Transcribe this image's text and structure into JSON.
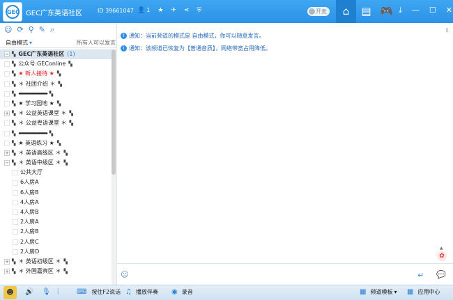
{
  "window": {
    "title": "GEC广东英语社区",
    "room_id": "ID 39661047",
    "online_count": "1",
    "open_label": "开麦"
  },
  "toolbar_icons": [
    "person-icon",
    "star-icon",
    "plane-icon",
    "share-icon",
    "shield-icon"
  ],
  "nav": [
    "home-icon",
    "list-icon",
    "gamepad-icon"
  ],
  "window_controls": [
    "download-icon",
    "minimize-icon",
    "maximize-icon",
    "close-icon"
  ],
  "left": {
    "mode": "自由模式",
    "mode_note": "所有人可以发言",
    "tree": [
      {
        "label": "GEC广东英语社区",
        "count": "(1)",
        "type": "root"
      },
      {
        "label": "公众号:GEConline",
        "type": "channel"
      },
      {
        "label": "★ 新人接待 ★",
        "type": "channel",
        "red": true
      },
      {
        "label": "＊ 社团介绍 ＊",
        "type": "channel"
      },
      {
        "label": "▬▬▬▬▬▬▬▬▬▬▬",
        "type": "divider"
      },
      {
        "label": "★ 学习园地 ★",
        "type": "channel"
      },
      {
        "label": "＊ 公益英语课堂 ＊",
        "type": "group"
      },
      {
        "label": "＊ 公益粤语课堂 ＊",
        "type": "channel"
      },
      {
        "label": "▬▬▬▬▬▬▬▬▬▬▬",
        "type": "divider"
      },
      {
        "label": "★ 英语练习 ★",
        "type": "channel"
      },
      {
        "label": "＊ 英语高级区 ＊",
        "type": "group"
      },
      {
        "label": "＊ 英语中级区 ＊",
        "type": "group-open"
      },
      {
        "label": "公共大厅",
        "type": "sub"
      },
      {
        "label": "6人房A",
        "type": "sub"
      },
      {
        "label": "6人房B",
        "type": "sub"
      },
      {
        "label": "4人房A",
        "type": "sub"
      },
      {
        "label": "4人房B",
        "type": "sub"
      },
      {
        "label": "2人房A",
        "type": "sub"
      },
      {
        "label": "2人房B",
        "type": "sub"
      },
      {
        "label": "2人房C",
        "type": "sub"
      },
      {
        "label": "2人房D",
        "type": "sub"
      },
      {
        "label": "＊ 英语初级区 ＊",
        "type": "group"
      },
      {
        "label": "＊ 外国嘉宾区 ＊",
        "type": "group"
      }
    ]
  },
  "chat": {
    "messages": [
      "通知：当前频道的模式是 自由模式，你可以随意发言。",
      "通知：该频道已恢复为【普通音质】，网络带宽占用降低。"
    ]
  },
  "bottom": {
    "ptt": "按住F2说话",
    "accompany": "播放伴奏",
    "record": "录音",
    "template": "频道模板",
    "app_center": "应用中心"
  }
}
